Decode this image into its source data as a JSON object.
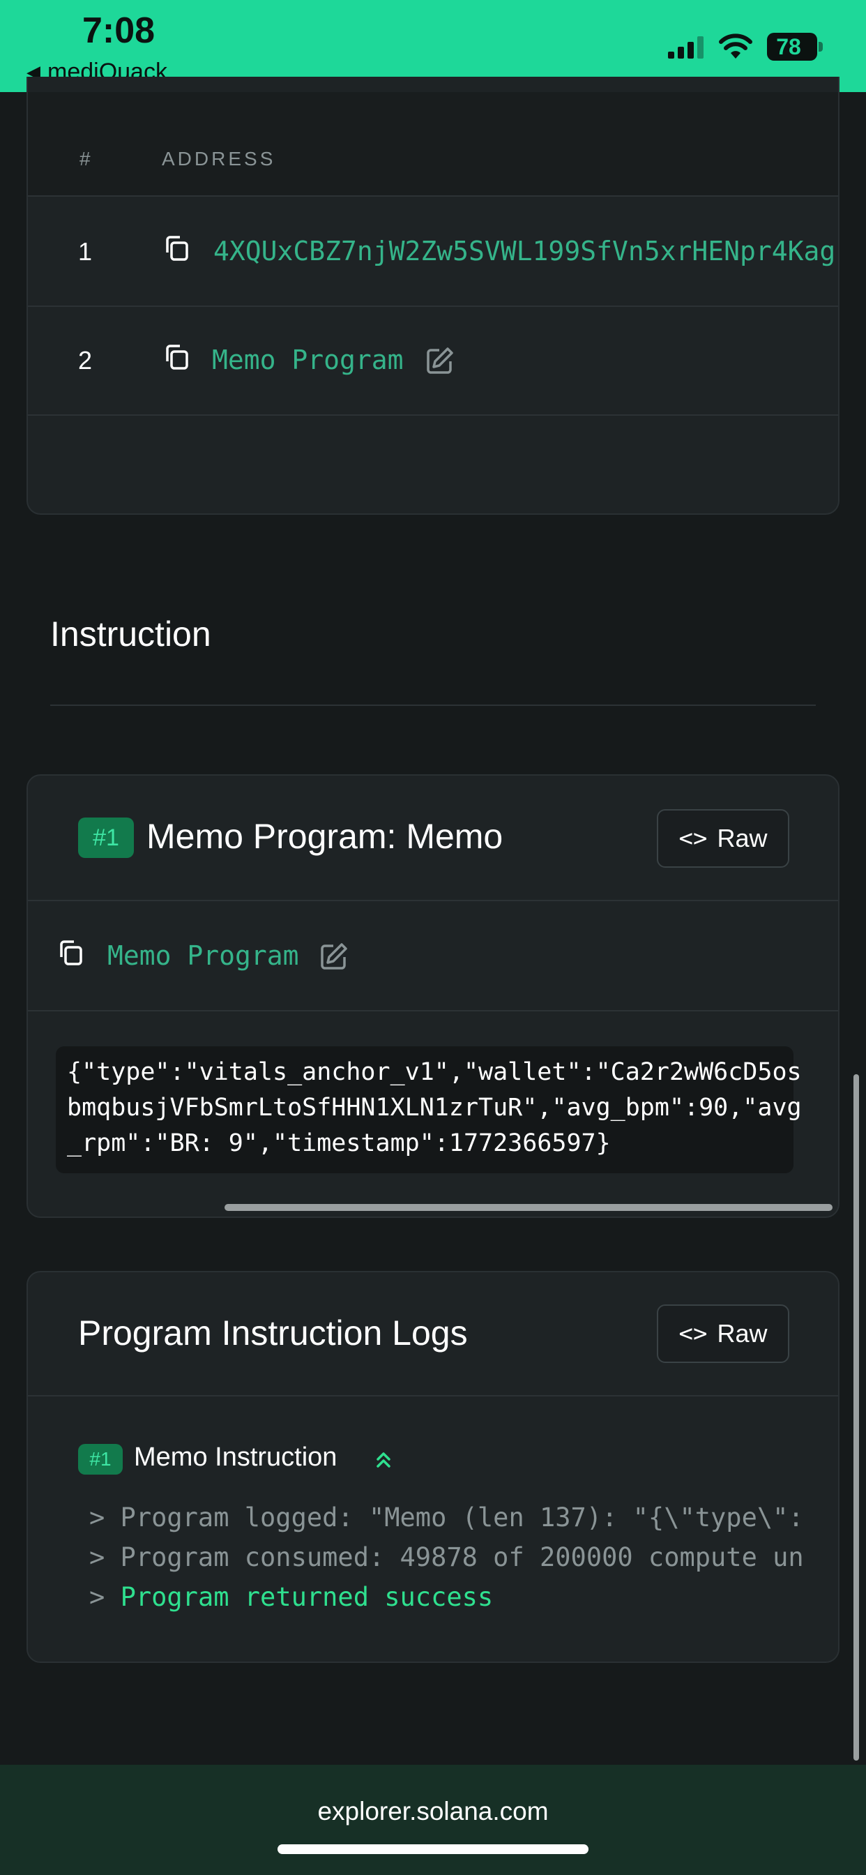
{
  "status_bar": {
    "time": "7:08",
    "back_app": "mediQuack",
    "battery": "78",
    "accent_color": "#1ed899"
  },
  "accounts_table": {
    "headers": {
      "num": "#",
      "address": "ADDRESS"
    },
    "rows": [
      {
        "num": "1",
        "address": "4XQUxCBZ7njW2Zw5SVWL199SfVn5xrHENpr4Kag",
        "editable": false
      },
      {
        "num": "2",
        "address": "Memo Program",
        "editable": true
      }
    ]
  },
  "instruction_section": {
    "title": "Instruction",
    "card": {
      "badge": "#1",
      "title": "Memo Program: Memo",
      "raw_label": "Raw",
      "program": "Memo Program",
      "memo_lines": [
        "{\"type\":\"vitals_anchor_v1\",\"wallet\":\"Ca2r2wW6cD5os",
        "bmqbusjVFbSmrLtoSfHHN1XLN1zrTuR\",\"avg_bpm\":90,\"avg",
        "_rpm\":\"BR: 9\",\"timestamp\":1772366597}"
      ]
    }
  },
  "logs_section": {
    "title": "Program Instruction Logs",
    "raw_label": "Raw",
    "badge": "#1",
    "instruction": "Memo Instruction",
    "lines": {
      "line1": "> Program logged: \"Memo (len 137): \"{\\\"type\\\":",
      "line2": "> Program consumed: 49878 of 200000 compute un",
      "line3_prefix": "> ",
      "line3_status": "Program returned success"
    },
    "success_color": "#2fe08f"
  },
  "browser": {
    "url": "explorer.solana.com"
  }
}
